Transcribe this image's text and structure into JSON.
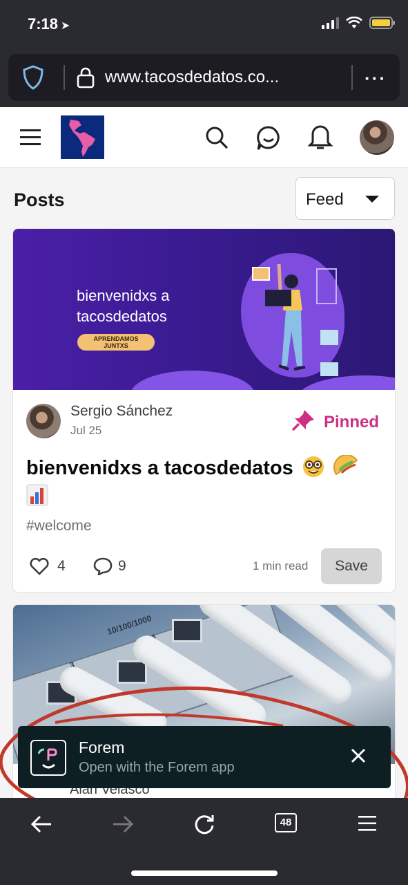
{
  "status_bar": {
    "time": "7:18",
    "location_glyph": "➤"
  },
  "browser": {
    "url": "www.tacosdedatos.co...",
    "more_label": "···",
    "tab_count": "48"
  },
  "header": {
    "logo_alt": "tacosdedatos logo"
  },
  "posts": {
    "title": "Posts",
    "feed_select": "Feed"
  },
  "post1": {
    "cover_title_line1": "bienvenidxs a",
    "cover_title_line2": "tacosdedatos",
    "cover_badge_line1": "APRENDAMOS",
    "cover_badge_line2": "JUNTXS",
    "author": "Sergio Sánchez",
    "date": "Jul 25",
    "pinned_label": "Pinned",
    "title": "bienvenidxs a tacosdedatos",
    "tag": "#welcome",
    "reactions": "4",
    "comments": "9",
    "read_time": "1 min read",
    "save_label": "Save"
  },
  "post2": {
    "author_partial": "Alan Velasco",
    "port_labels": [
      "10/100/1000",
      "4",
      "3"
    ]
  },
  "app_banner": {
    "name": "Forem",
    "subtitle": "Open with the Forem app"
  },
  "colors": {
    "accent_pink": "#cf2e85",
    "annotation_red": "#c0392b",
    "banner_bg": "#0d1f22"
  }
}
